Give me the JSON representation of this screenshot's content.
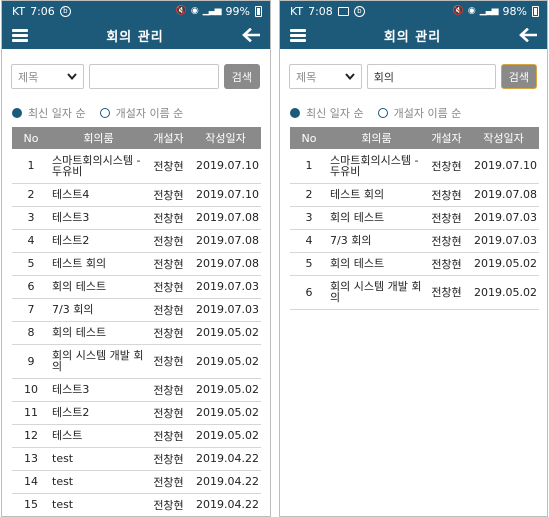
{
  "screens": [
    {
      "status": {
        "carrier": "KT",
        "time": "7:06",
        "battery": "99%"
      },
      "app_bar": {
        "title": "회의 관리"
      },
      "search": {
        "field_option": "제목",
        "query": "",
        "button_label": "검색"
      },
      "sort": {
        "option1": "최신 일자 순",
        "option2": "개설자 이름 순"
      },
      "table": {
        "headers": [
          "No",
          "회의룸",
          "개설자",
          "작성일자"
        ],
        "rows": [
          {
            "no": "1",
            "name": "스마트회의시스템 - 두유비",
            "creator": "전창현",
            "date": "2019.07.10"
          },
          {
            "no": "2",
            "name": "테스트4",
            "creator": "전창현",
            "date": "2019.07.10"
          },
          {
            "no": "3",
            "name": "테스트3",
            "creator": "전창현",
            "date": "2019.07.08"
          },
          {
            "no": "4",
            "name": "테스트2",
            "creator": "전창현",
            "date": "2019.07.08"
          },
          {
            "no": "5",
            "name": "테스트 회의",
            "creator": "전창현",
            "date": "2019.07.08"
          },
          {
            "no": "6",
            "name": "회의 테스트",
            "creator": "전창현",
            "date": "2019.07.03"
          },
          {
            "no": "7",
            "name": "7/3 회의",
            "creator": "전창현",
            "date": "2019.07.03"
          },
          {
            "no": "8",
            "name": "회의 테스트",
            "creator": "전창현",
            "date": "2019.05.02"
          },
          {
            "no": "9",
            "name": "회의 시스템 개발 회의",
            "creator": "전창현",
            "date": "2019.05.02"
          },
          {
            "no": "10",
            "name": "테스트3",
            "creator": "전창현",
            "date": "2019.05.02"
          },
          {
            "no": "11",
            "name": "테스트2",
            "creator": "전창현",
            "date": "2019.05.02"
          },
          {
            "no": "12",
            "name": "테스트",
            "creator": "전창현",
            "date": "2019.05.02"
          },
          {
            "no": "13",
            "name": "test",
            "creator": "전창현",
            "date": "2019.04.22"
          },
          {
            "no": "14",
            "name": "test",
            "creator": "전창현",
            "date": "2019.04.22"
          },
          {
            "no": "15",
            "name": "test",
            "creator": "전창현",
            "date": "2019.04.22"
          }
        ]
      }
    },
    {
      "status": {
        "carrier": "KT",
        "time": "7:08",
        "battery": "98%"
      },
      "app_bar": {
        "title": "회의 관리"
      },
      "search": {
        "field_option": "제목",
        "query": "회의",
        "button_label": "검색"
      },
      "sort": {
        "option1": "최신 일자 순",
        "option2": "개설자 이름 순"
      },
      "table": {
        "headers": [
          "No",
          "회의룸",
          "개설자",
          "작성일자"
        ],
        "rows": [
          {
            "no": "1",
            "name": "스마트회의시스템 - 두유비",
            "creator": "전창현",
            "date": "2019.07.10"
          },
          {
            "no": "2",
            "name": "테스트 회의",
            "creator": "전창현",
            "date": "2019.07.08"
          },
          {
            "no": "3",
            "name": "회의 테스트",
            "creator": "전창현",
            "date": "2019.07.03"
          },
          {
            "no": "4",
            "name": "7/3 회의",
            "creator": "전창현",
            "date": "2019.07.03"
          },
          {
            "no": "5",
            "name": "회의 테스트",
            "creator": "전창현",
            "date": "2019.05.02"
          },
          {
            "no": "6",
            "name": "회의 시스템 개발 회의",
            "creator": "전창현",
            "date": "2019.05.02"
          }
        ]
      }
    }
  ],
  "theme": {
    "primary": "#1d5a7a",
    "header_gray": "#8a8a8a",
    "highlight_border": "#d7a540"
  },
  "icons": [
    "menu-icon",
    "back-arrow-icon",
    "chevron-down-icon",
    "radio-selected-icon",
    "radio-unselected-icon",
    "wifi-icon",
    "signal-icon",
    "battery-icon"
  ]
}
